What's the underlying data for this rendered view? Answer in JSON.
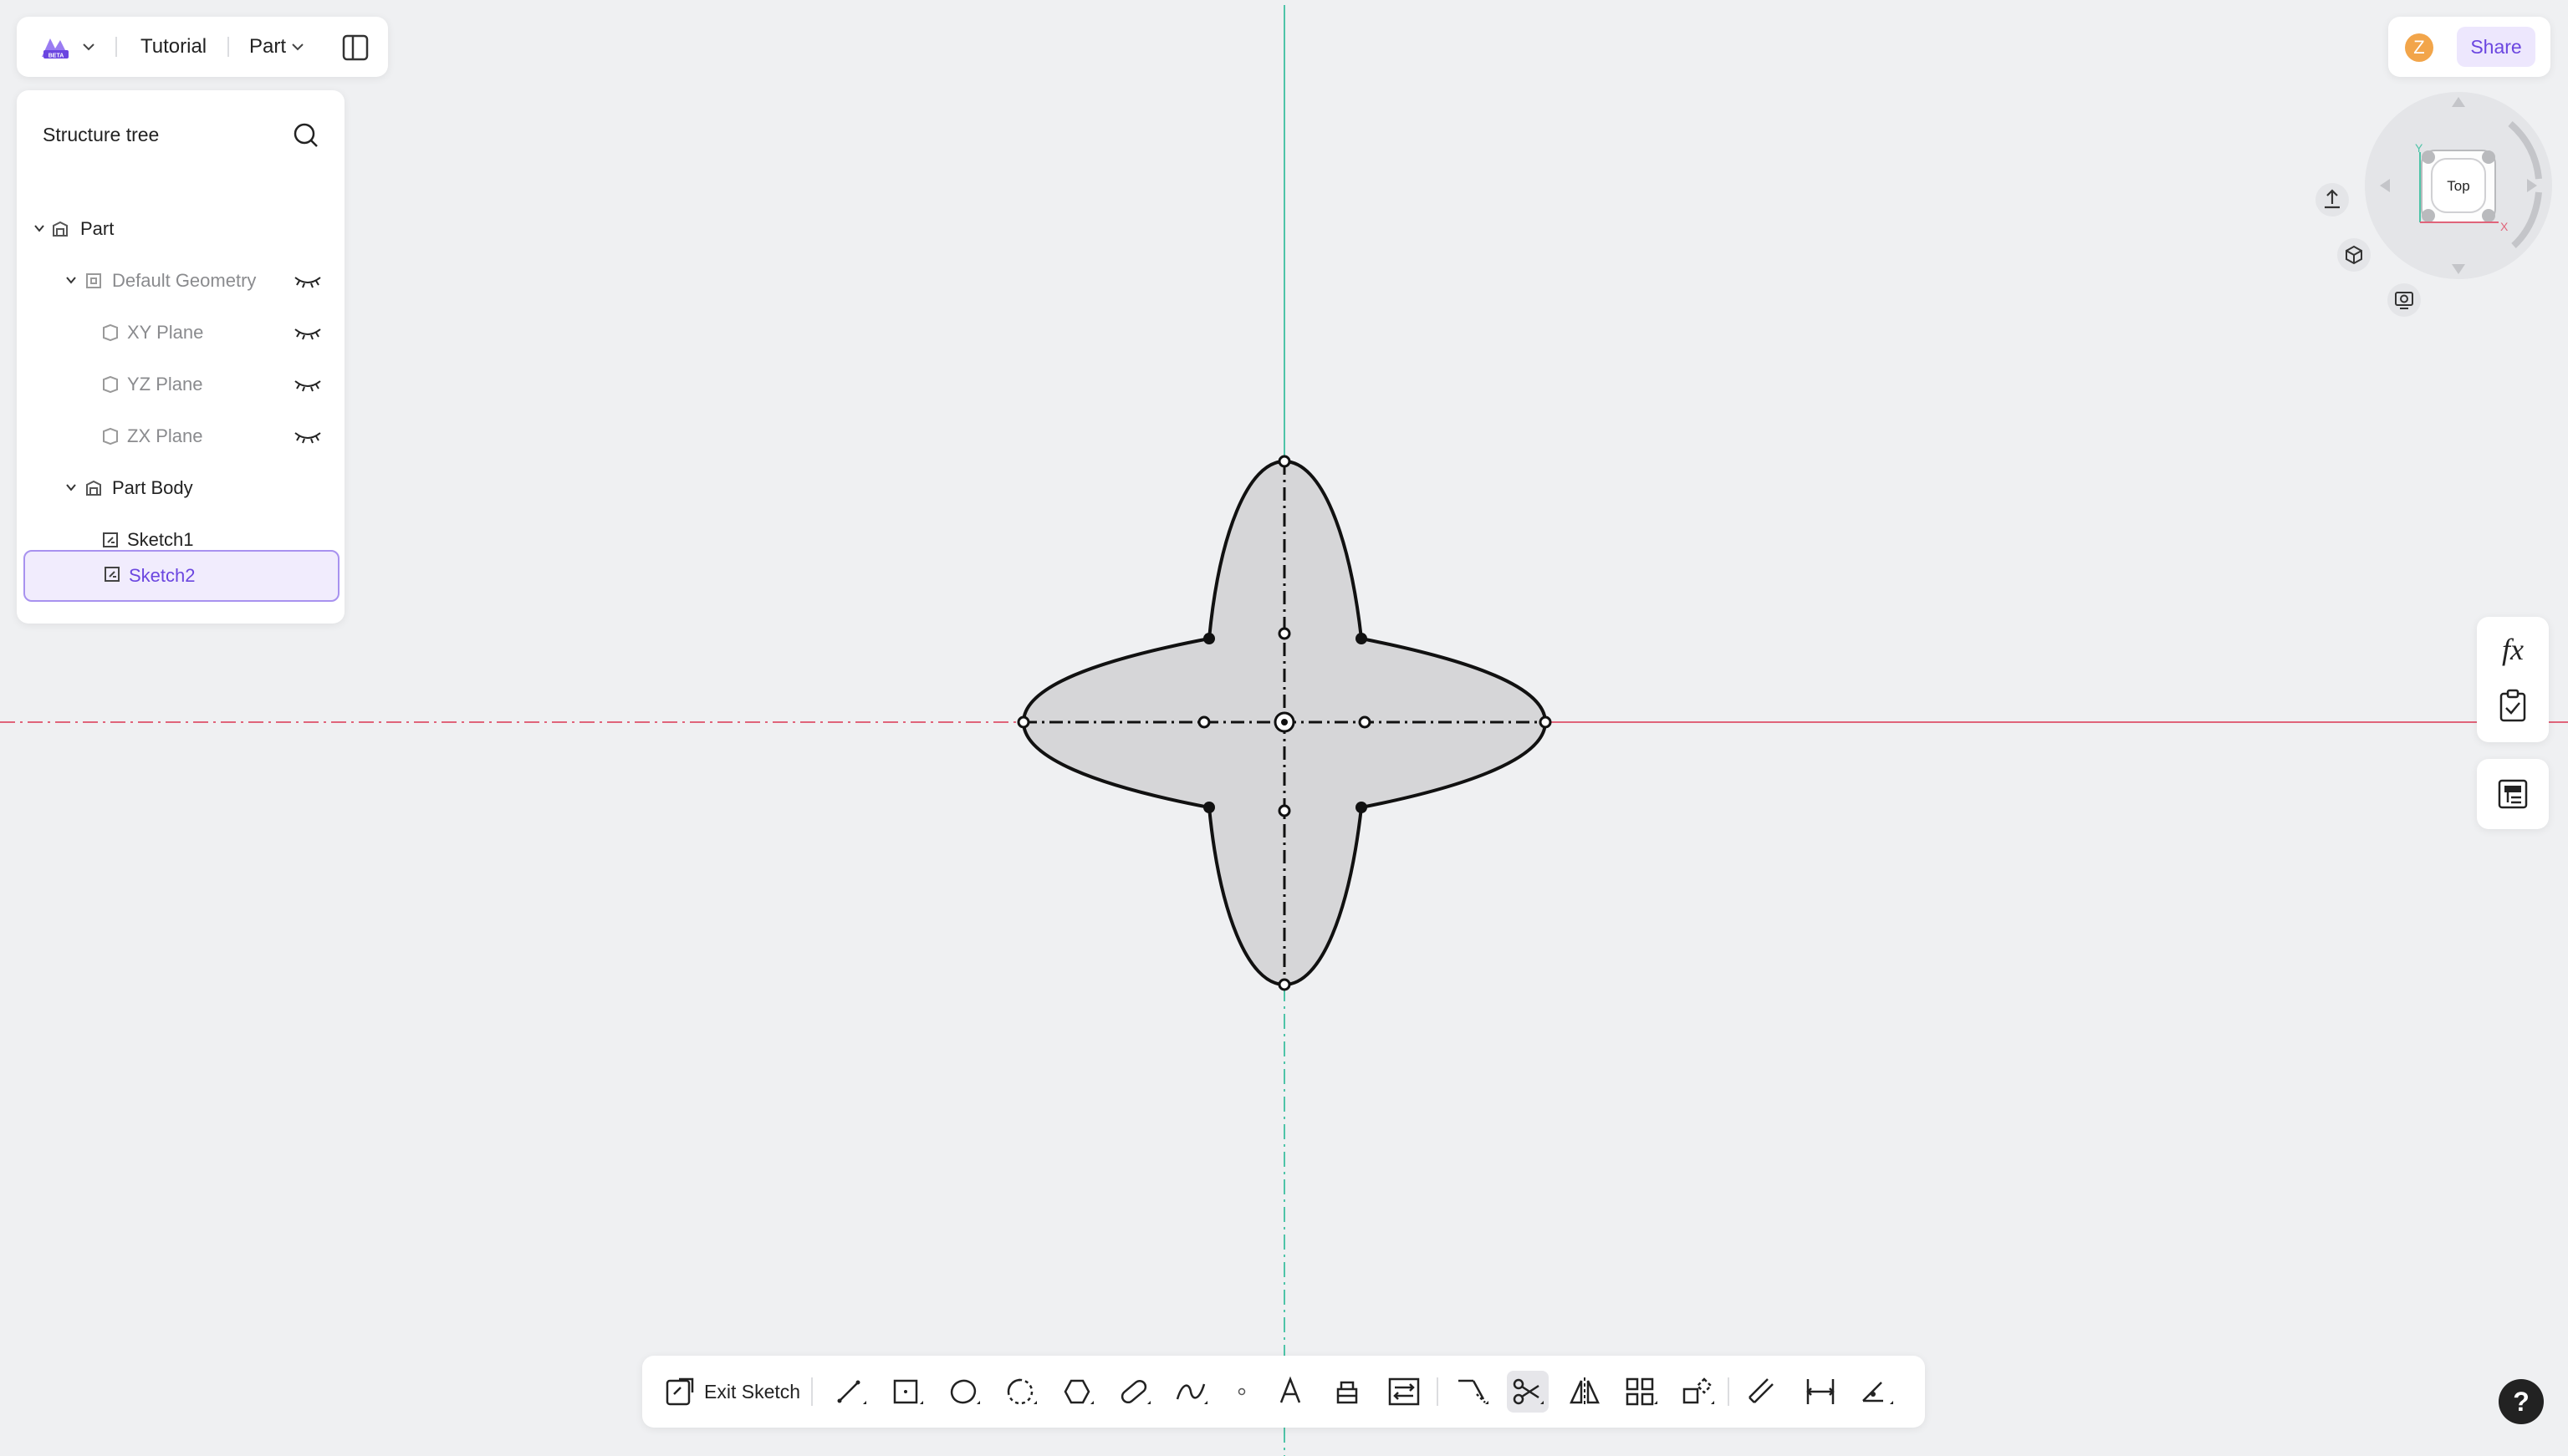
{
  "header": {
    "project_name": "Tutorial",
    "mode_label": "Part"
  },
  "tree": {
    "title": "Structure tree",
    "items": [
      {
        "label": "Part"
      },
      {
        "label": "Default Geometry"
      },
      {
        "label": "XY Plane"
      },
      {
        "label": "YZ Plane"
      },
      {
        "label": "ZX Plane"
      },
      {
        "label": "Part Body"
      },
      {
        "label": "Sketch1"
      },
      {
        "label": "Sketch2"
      }
    ]
  },
  "user": {
    "avatar_initial": "Z",
    "share_label": "Share"
  },
  "view_cube": {
    "face_label": "Top",
    "axis_x": "X",
    "axis_y": "Y"
  },
  "side_tools": {
    "fx_label": "fx"
  },
  "toolbar": {
    "exit_label": "Exit Sketch",
    "tools": [
      "line-tool",
      "rectangle-tool",
      "circle-tool",
      "arc-tool",
      "polygon-tool",
      "slot-tool",
      "spline-tool",
      "point-tool",
      "text-tool",
      "project-tool",
      "convert-tool",
      "trim-extend-tool",
      "trim-tool",
      "mirror-tool",
      "pattern-tool",
      "transform-tool",
      "offset-tool",
      "dimension-tool",
      "constraint-tool"
    ]
  },
  "help": {
    "label": "?"
  },
  "colors": {
    "accent": "#6b46e0",
    "x_axis": "#e0647a",
    "y_axis": "#4fc4a8",
    "sketch_fill": "#d6d6d8",
    "canvas_bg": "#eff0f2"
  }
}
